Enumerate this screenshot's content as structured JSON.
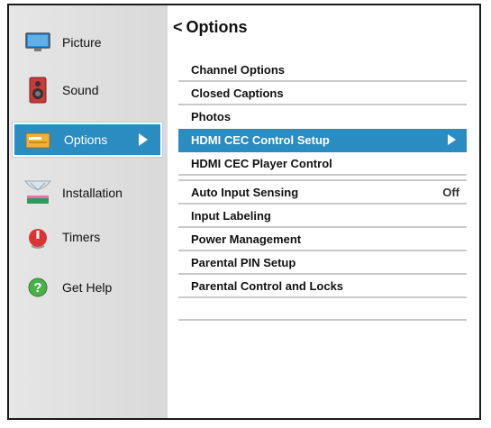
{
  "sidebar": {
    "items": [
      {
        "label": "Picture",
        "icon": "tv-icon"
      },
      {
        "label": "Sound",
        "icon": "speaker-icon"
      },
      {
        "label": "Options",
        "icon": "options-box-icon"
      },
      {
        "label": "Installation",
        "icon": "satellite-dish-icon"
      },
      {
        "label": "Timers",
        "icon": "timer-icon"
      },
      {
        "label": "Get Help",
        "icon": "help-icon"
      }
    ],
    "active_index": 2
  },
  "main": {
    "title": "Options",
    "back_glyph": "<",
    "rows": [
      {
        "label": "Channel Options",
        "value": ""
      },
      {
        "label": "Closed Captions",
        "value": ""
      },
      {
        "label": "Photos",
        "value": ""
      },
      {
        "label": "HDMI CEC Control Setup",
        "value": ""
      },
      {
        "label": "HDMI CEC Player Control",
        "value": ""
      },
      {
        "label": "Auto Input Sensing",
        "value": "Off"
      },
      {
        "label": "Input Labeling",
        "value": ""
      },
      {
        "label": "Power Management",
        "value": ""
      },
      {
        "label": "Parental PIN Setup",
        "value": ""
      },
      {
        "label": "Parental Control and Locks",
        "value": ""
      }
    ],
    "selected_index": 3
  },
  "colors": {
    "accent": "#2a8cc0",
    "sidebar_bg": "#dcdcdc",
    "divider": "#c9c9c9"
  }
}
